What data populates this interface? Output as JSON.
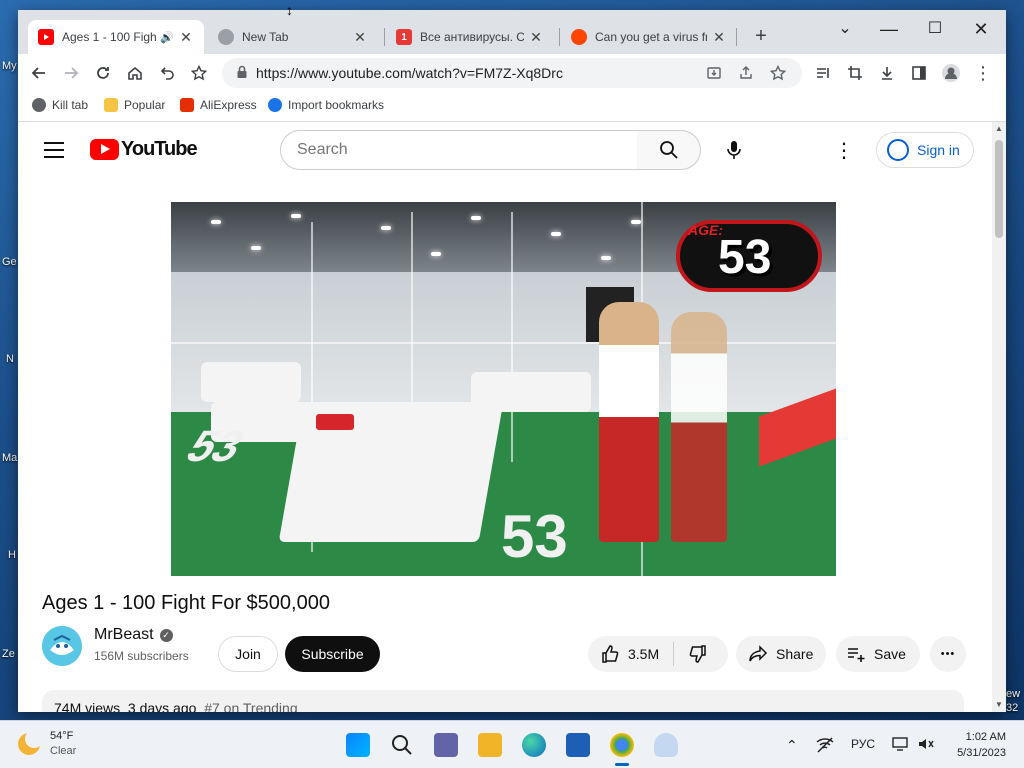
{
  "desktop": {
    "labels": [
      "My",
      "Ge",
      "N",
      "Ma",
      "H",
      "Ze",
      "ew",
      "32"
    ]
  },
  "browser": {
    "tabs": [
      {
        "title": "Ages 1 - 100 Figh",
        "active": true
      },
      {
        "title": "New Tab",
        "active": false
      },
      {
        "title": "Все антивирусы. Ска",
        "active": false
      },
      {
        "title": "Can you get a virus fr",
        "active": false
      }
    ],
    "new_tab_label": "+",
    "url": "https://www.youtube.com/watch?v=FM7Z-Xq8Drc",
    "bookmarks": [
      {
        "label": "Kill tab"
      },
      {
        "label": "Popular"
      },
      {
        "label": "AliExpress"
      },
      {
        "label": "Import bookmarks"
      }
    ]
  },
  "youtube": {
    "logo_text": "YouTube",
    "search_placeholder": "Search",
    "sign_in_label": "Sign in",
    "video": {
      "age_label": "AGE:",
      "age_value": "53"
    },
    "title": "Ages 1 - 100 Fight For $500,000",
    "channel": {
      "name": "MrBeast",
      "subscribers": "156M subscribers",
      "verified_mark": "✓"
    },
    "join_label": "Join",
    "subscribe_label": "Subscribe",
    "like_count": "3.5M",
    "share_label": "Share",
    "save_label": "Save",
    "more_label": "•••",
    "description": {
      "views": "74M views",
      "age": "3 days ago",
      "trending": "#7 on Trending"
    }
  },
  "taskbar": {
    "weather_temp": "54°F",
    "weather_cond": "Clear",
    "language": "РУС",
    "time": "1:02 AM",
    "date": "5/31/2023"
  },
  "colors": {
    "youtube_red": "#ff0000",
    "link_blue": "#065fd4",
    "taskbar_bg": "#eef2f7"
  }
}
